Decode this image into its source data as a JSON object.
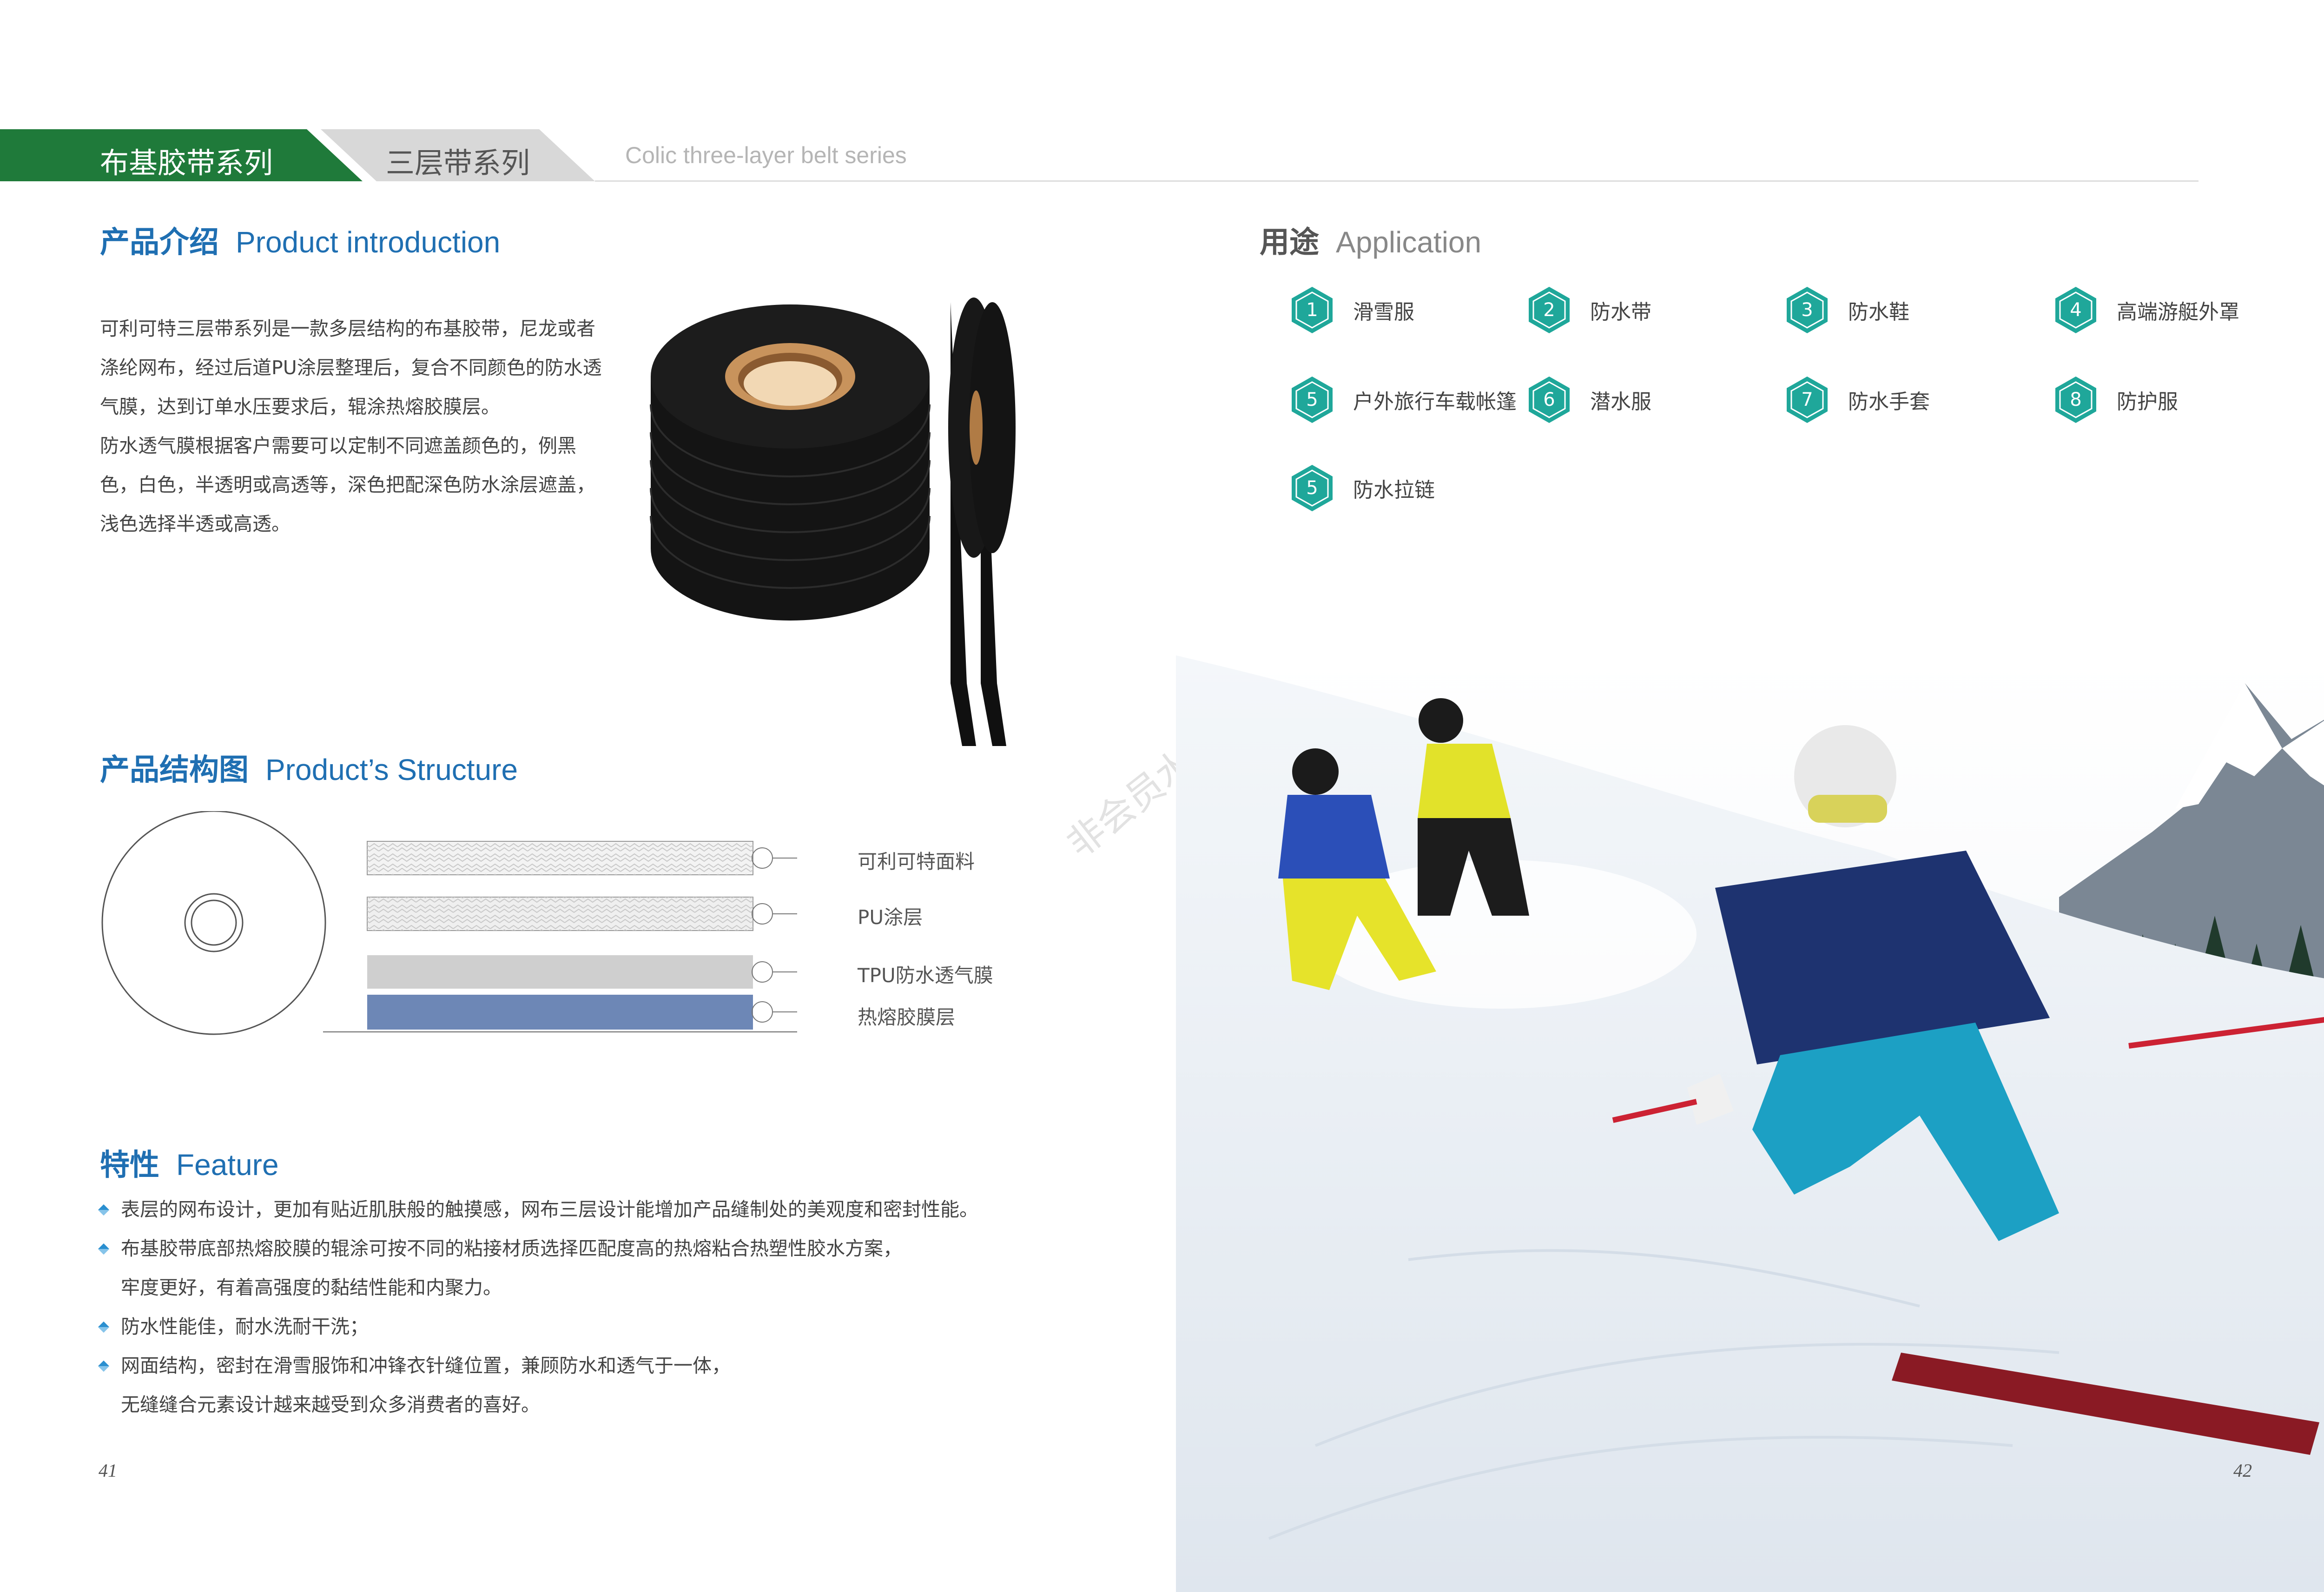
{
  "header": {
    "tab_primary": "布基胶带系列",
    "tab_secondary": "三层带系列",
    "subtitle": "Colic three-layer belt series"
  },
  "intro": {
    "title_cn": "产品介绍",
    "title_en": "Product introduction",
    "paragraph1": "可利可特三层带系列是一款多层结构的布基胶带，尼龙或者涤纶网布，经过后道PU涂层整理后，复合不同颜色的防水透气膜，达到订单水压要求后，辊涂热熔胶膜层。",
    "paragraph2": "防水透气膜根据客户需要可以定制不同遮盖颜色的，例黑色，白色，半透明或高透等，深色把配深色防水涂层遮盖，浅色选择半透或高透。"
  },
  "structure": {
    "title_cn": "产品结构图",
    "title_en": "Product’s Structure",
    "layers": [
      {
        "label": "可利可特面料",
        "color": "#f2f2f2"
      },
      {
        "label": "PU涂层",
        "color": "#eeeeee"
      },
      {
        "label": "TPU防水透气膜",
        "color": "#cfcfcf"
      },
      {
        "label": "热熔胶膜层",
        "color": "#6d87b6"
      }
    ]
  },
  "feature": {
    "title_cn": "特性",
    "title_en": "Feature",
    "items": [
      {
        "line1": "表层的网布设计，更加有贴近肌肤般的触摸感，网布三层设计能增加产品缝制处的美观度和密封性能。",
        "line2": ""
      },
      {
        "line1": "布基胶带底部热熔胶膜的辊涂可按不同的粘接材质选择匹配度高的热熔粘合热塑性胶水方案，",
        "line2": "牢度更好，有着高强度的黏结性能和内聚力。"
      },
      {
        "line1": "防水性能佳，耐水洗耐干洗；",
        "line2": ""
      },
      {
        "line1": "网面结构，密封在滑雪服饰和冲锋衣针缝位置，兼顾防水和透气于一体，",
        "line2": "无缝缝合元素设计越来越受到众多消费者的喜好。"
      }
    ]
  },
  "application": {
    "title_cn": "用途",
    "title_en": "Application",
    "items": [
      {
        "num": "1",
        "label": "滑雪服"
      },
      {
        "num": "2",
        "label": "防水带"
      },
      {
        "num": "3",
        "label": "防水鞋"
      },
      {
        "num": "4",
        "label": "高端游艇外罩"
      },
      {
        "num": "5",
        "label": "户外旅行车载帐篷"
      },
      {
        "num": "6",
        "label": "潜水服"
      },
      {
        "num": "7",
        "label": "防水手套"
      },
      {
        "num": "8",
        "label": "防护服"
      },
      {
        "num": "5",
        "label": "防水拉链"
      }
    ],
    "hex_color": "#1fa79a"
  },
  "watermark": "非会员水印",
  "page_numbers": {
    "left": "41",
    "right": "42"
  },
  "colors": {
    "brand_green": "#1f7a3a",
    "heading_blue": "#1f6fb2",
    "teal": "#1fa79a"
  }
}
